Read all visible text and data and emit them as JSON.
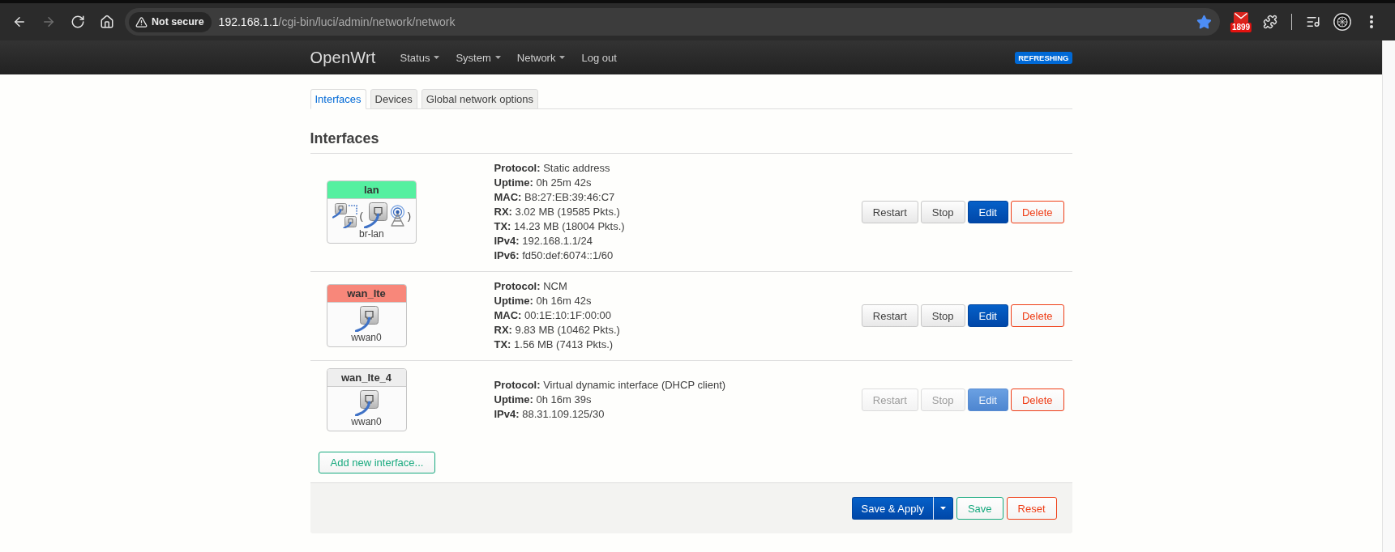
{
  "browser": {
    "nav_buttons": [
      {
        "kind": "back",
        "disabled": false
      },
      {
        "kind": "forward",
        "disabled": true
      },
      {
        "kind": "reload",
        "disabled": false
      },
      {
        "kind": "home",
        "disabled": false
      }
    ],
    "security_label": "Not secure",
    "url": {
      "host": "192.168.1.1",
      "path": "/cgi-bin/luci/admin/network/network"
    },
    "bookmarked": true,
    "mail_badge": "1899"
  },
  "navbar": {
    "brand": "OpenWrt",
    "menu": [
      {
        "label": "Status",
        "dropdown": true
      },
      {
        "label": "System",
        "dropdown": true
      },
      {
        "label": "Network",
        "dropdown": true
      },
      {
        "label": "Log out",
        "dropdown": false
      }
    ],
    "indicator": "REFRESHING"
  },
  "tabs": [
    {
      "label": "Interfaces",
      "selected": true
    },
    {
      "label": "Devices",
      "selected": false
    },
    {
      "label": "Global network options",
      "selected": false
    }
  ],
  "heading": "Interfaces",
  "interfaces": [
    {
      "name": "lan",
      "color": "#55f0a0",
      "device": {
        "kind": "bridge",
        "name": "br-lan",
        "open": "(",
        "members": [
          {
            "kind": "ethernet"
          },
          {
            "kind": "wireless"
          }
        ],
        "close": ")"
      },
      "details": [
        "**Protocol:** Static address",
        "**Uptime:** 0h 25m 42s",
        "**MAC:** B8:27:EB:39:46:C7",
        "**RX:** 3.02 MB (19585 Pkts.)",
        "**TX:** 14.23 MB (18004 Pkts.)",
        "**IPv4:** 192.168.1.1/24",
        "**IPv6:** fd50:def:6074::1/60"
      ],
      "actions": [
        {
          "kind": "restart",
          "label": "Restart",
          "disabled": false
        },
        {
          "kind": "stop",
          "label": "Stop",
          "disabled": false
        },
        {
          "kind": "edit",
          "label": "Edit",
          "disabled": false
        },
        {
          "kind": "delete",
          "label": "Delete",
          "disabled": false
        }
      ]
    },
    {
      "name": "wan_lte",
      "color": "#f8877a",
      "device": {
        "kind": "ethernet",
        "name": "wwan0"
      },
      "details": [
        "**Protocol:** NCM",
        "**Uptime:** 0h 16m 42s",
        "**MAC:** 00:1E:10:1F:00:00",
        "**RX:** 9.83 MB (10462 Pkts.)",
        "**TX:** 1.56 MB (7413 Pkts.)"
      ],
      "actions": [
        {
          "kind": "restart",
          "label": "Restart",
          "disabled": false
        },
        {
          "kind": "stop",
          "label": "Stop",
          "disabled": false
        },
        {
          "kind": "edit",
          "label": "Edit",
          "disabled": false
        },
        {
          "kind": "delete",
          "label": "Delete",
          "disabled": false
        }
      ]
    },
    {
      "name": "wan_lte_4",
      "color": "#eeeeee",
      "device": {
        "kind": "ethernet",
        "name": "wwan0"
      },
      "details": [
        "**Protocol:** Virtual dynamic interface (DHCP client)",
        "**Uptime:** 0h 16m 39s",
        "**IPv4:** 88.31.109.125/30"
      ],
      "actions": [
        {
          "kind": "restart",
          "label": "Restart",
          "disabled": true
        },
        {
          "kind": "stop",
          "label": "Stop",
          "disabled": true
        },
        {
          "kind": "edit",
          "label": "Edit",
          "disabled": true
        },
        {
          "kind": "delete",
          "label": "Delete",
          "disabled": false
        }
      ]
    }
  ],
  "add_button": "Add new interface...",
  "footer_actions": [
    {
      "kind": "save-apply",
      "label": "Save & Apply"
    },
    {
      "kind": "save",
      "label": "Save"
    },
    {
      "kind": "reset",
      "label": "Reset"
    }
  ]
}
